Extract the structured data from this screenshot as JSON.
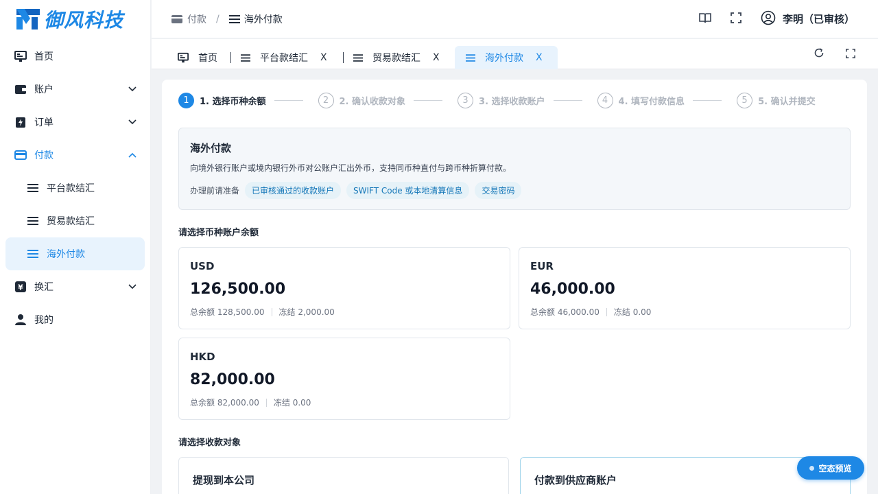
{
  "app": {
    "brand": "御风科技"
  },
  "breadcrumb": {
    "parent": "付款",
    "sep": "/",
    "current": "海外付款"
  },
  "user": {
    "name": "李明（已审核）"
  },
  "sidebar": {
    "items": [
      {
        "label": "首页"
      },
      {
        "label": "账户"
      },
      {
        "label": "订单"
      },
      {
        "label": "付款"
      },
      {
        "label": "平台款结汇"
      },
      {
        "label": "贸易款结汇"
      },
      {
        "label": "海外付款"
      },
      {
        "label": "换汇"
      },
      {
        "label": "我的"
      }
    ]
  },
  "tabs": [
    {
      "label": "首页"
    },
    {
      "label": "平台款结汇",
      "close": "X"
    },
    {
      "label": "贸易款结汇",
      "close": "X"
    },
    {
      "label": "海外付款",
      "close": "X"
    }
  ],
  "steps": [
    {
      "num": "1",
      "label": "1. 选择币种余额"
    },
    {
      "num": "2",
      "label": "2. 确认收款对象"
    },
    {
      "num": "3",
      "label": "3. 选择收款账户"
    },
    {
      "num": "4",
      "label": "4. 填写付款信息"
    },
    {
      "num": "5",
      "label": "5. 确认并提交"
    }
  ],
  "info": {
    "title": "海外付款",
    "desc": "向境外银行账户或境内银行外币对公账户汇出外币，支持同币种直付与跨币种折算付款。",
    "prep_label": "办理前请准备",
    "chips": [
      "已审核通过的收款账户",
      "SWIFT Code 或本地清算信息",
      "交易密码"
    ]
  },
  "balances": {
    "title": "请选择币种账户余额",
    "accounts": [
      {
        "currency": "USD",
        "balance": "126,500.00",
        "total": "总余额 128,500.00",
        "frozen": "冻结 2,000.00"
      },
      {
        "currency": "EUR",
        "balance": "46,000.00",
        "total": "总余额 46,000.00",
        "frozen": "冻结 0.00"
      },
      {
        "currency": "HKD",
        "balance": "82,000.00",
        "total": "总余额 82,000.00",
        "frozen": "冻结 0.00"
      }
    ]
  },
  "payees": {
    "title": "请选择收款对象",
    "options": [
      {
        "label": "提现到本公司"
      },
      {
        "label": "付款到供应商账户"
      }
    ]
  },
  "preview_button": {
    "label": "空态预览"
  }
}
